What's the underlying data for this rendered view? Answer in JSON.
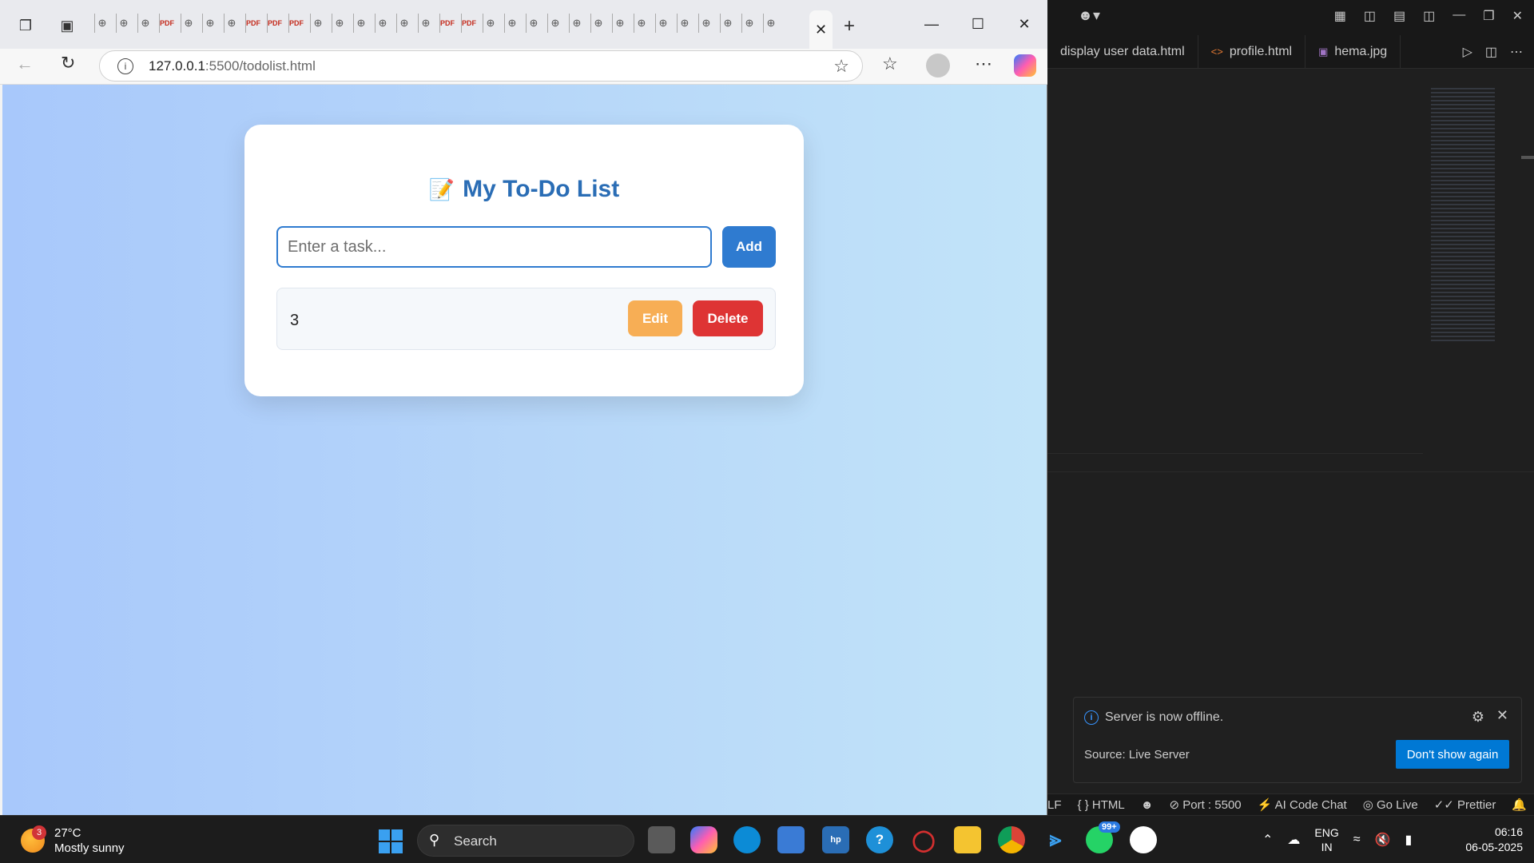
{
  "vscode": {
    "tabs": [
      {
        "label": "display user data.html",
        "icon": "html-icon"
      },
      {
        "label": "profile.html",
        "icon": "code-icon"
      },
      {
        "label": "hema.jpg",
        "icon": "image-icon"
      }
    ],
    "notification": {
      "message": "Server is now offline.",
      "source": "Source: Live Server",
      "button": "Don't show again"
    },
    "status_items": [
      "LF",
      "{ } HTML",
      "Port : 5500",
      "AI Code Chat",
      "Go Live",
      "Prettier"
    ]
  },
  "browser": {
    "url_host": "127.0.0.1",
    "url_rest": ":5500/todolist.html",
    "tab_count_shown": 32
  },
  "page": {
    "title": "My To-Do List",
    "title_emoji": "📝",
    "input_placeholder": "Enter a task...",
    "add_label": "Add",
    "tasks": [
      {
        "text": "3",
        "edit_label": "Edit",
        "delete_label": "Delete"
      }
    ]
  },
  "taskbar": {
    "weather_temp": "27°C",
    "weather_condition": "Mostly sunny",
    "weather_badge": "3",
    "search_label": "Search",
    "whatsapp_badge": "99+",
    "lang_top": "ENG",
    "lang_bottom": "IN",
    "time": "06:16",
    "date": "06-05-2025"
  },
  "colors": {
    "accent_blue": "#2f7bd0",
    "edit_orange": "#f7ae55",
    "delete_red": "#de3434",
    "title_blue": "#2a6db5"
  }
}
